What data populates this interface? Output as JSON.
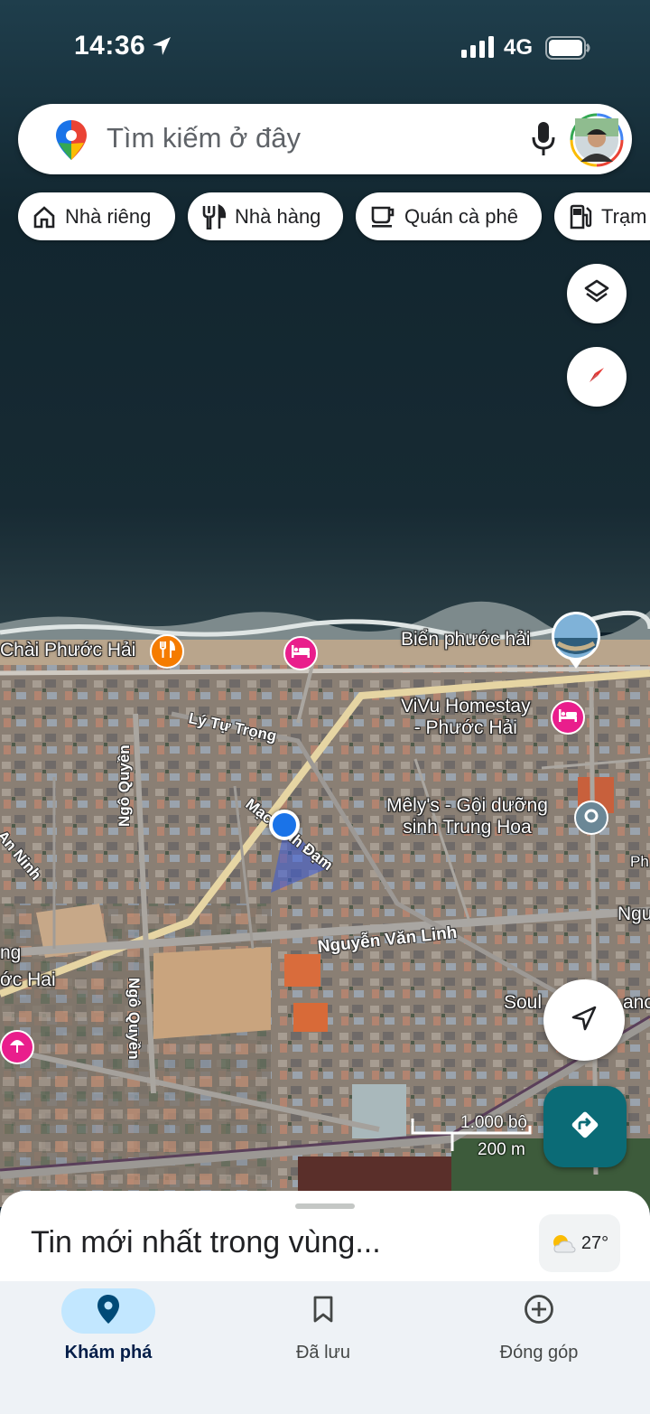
{
  "status_bar": {
    "time": "14:36",
    "network": "4G"
  },
  "search": {
    "placeholder": "Tìm kiếm ở đây"
  },
  "chips": [
    {
      "label": "Nhà riêng",
      "icon": "home-icon"
    },
    {
      "label": "Nhà hàng",
      "icon": "restaurant-icon"
    },
    {
      "label": "Quán cà phê",
      "icon": "coffee-icon"
    },
    {
      "label": "Trạm",
      "icon": "gas-station-icon"
    }
  ],
  "map": {
    "places": [
      {
        "label": "Chài Phước Hải",
        "icon": "restaurant-icon",
        "color": "#f57c00"
      },
      {
        "label": "Biển phước hải",
        "icon": "photo-pin-icon"
      },
      {
        "label": "ViVu Homestay\n- Phước Hải",
        "icon": "hotel-icon",
        "color": "#e91e8c"
      },
      {
        "label": "Mêly's - Gội dưỡng\nsinh Trung Hoa",
        "icon": "place-icon",
        "color": "#5f7a8a"
      },
      {
        "label": "Soul",
        "icon": "place-icon"
      },
      {
        "label": "ng\nớc Hai",
        "icon": ""
      }
    ],
    "streets": [
      "Lý Tự Trọng",
      "Ngô Quyền",
      "Mạc Đĩnh Đạm",
      "Nguyễn Văn Linh",
      "Ngô Quyền",
      "An Ninh",
      "Ngu",
      "Ph",
      "anc"
    ],
    "scale": {
      "imperial": "1.000 bộ",
      "metric": "200 m"
    }
  },
  "sheet": {
    "title": "Tin mới nhất trong vùng...",
    "temperature": "27°"
  },
  "nav": [
    {
      "label": "Khám phá",
      "icon": "explore-pin-icon",
      "active": true
    },
    {
      "label": "Đã lưu",
      "icon": "bookmark-icon",
      "active": false
    },
    {
      "label": "Đóng góp",
      "icon": "add-circle-icon",
      "active": false
    }
  ],
  "colors": {
    "accent": "#0b6b76",
    "nav_active": "#c2e7ff",
    "hotel": "#e91e8c",
    "restaurant": "#f57c00"
  }
}
